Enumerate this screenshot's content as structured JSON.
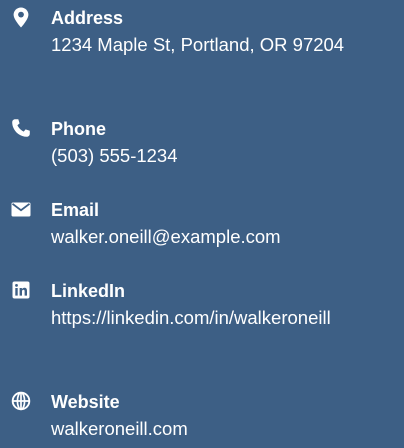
{
  "contacts": [
    {
      "label": "Address",
      "value": "1234 Maple St, Portland, OR 97204",
      "icon": "map-marker-icon"
    },
    {
      "label": "Phone",
      "value": "(503) 555-1234",
      "icon": "phone-icon"
    },
    {
      "label": "Email",
      "value": "walker.oneill@example.com",
      "icon": "envelope-icon"
    },
    {
      "label": "LinkedIn",
      "value": "https://linkedin.com/in/walkeroneill",
      "icon": "linkedin-icon"
    },
    {
      "label": "Website",
      "value": "walkeroneill.com",
      "icon": "globe-icon"
    }
  ],
  "colors": {
    "background": "#3d5f85",
    "text": "#ffffff"
  }
}
